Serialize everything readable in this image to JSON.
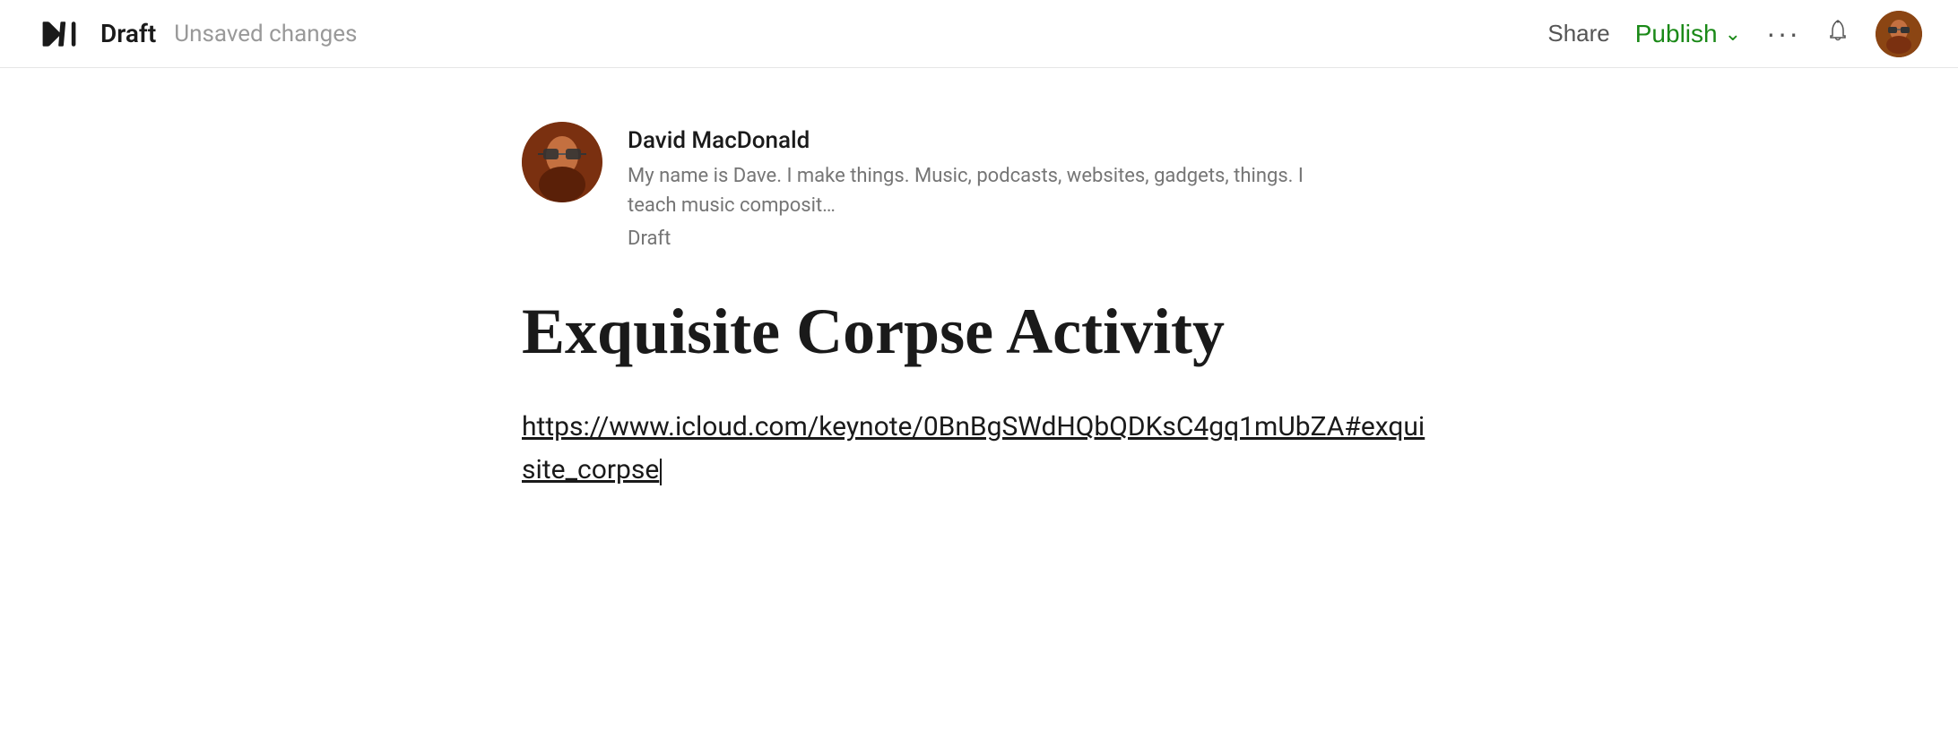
{
  "topbar": {
    "draft_label": "Draft",
    "unsaved_label": "Unsaved changes",
    "share_label": "Share",
    "publish_label": "Publish",
    "logo_alt": "Medium logo"
  },
  "author": {
    "name": "David MacDonald",
    "bio": "My name is Dave. I make things. Music, podcasts, websites, gadgets, things. I teach music composit…",
    "status": "Draft"
  },
  "article": {
    "title": "Exquisite Corpse Activity",
    "link": "https://www.icloud.com/keynote/0BnBgSWdHQbQDKsC4gq1mUbZA#exquisite_corpse"
  },
  "icons": {
    "chevron_down": "∨",
    "more": "•••",
    "bell": "🔔"
  },
  "colors": {
    "publish_green": "#1a8917",
    "text_primary": "#1a1a1a",
    "text_secondary": "#757575",
    "border": "#e6e6e6"
  }
}
